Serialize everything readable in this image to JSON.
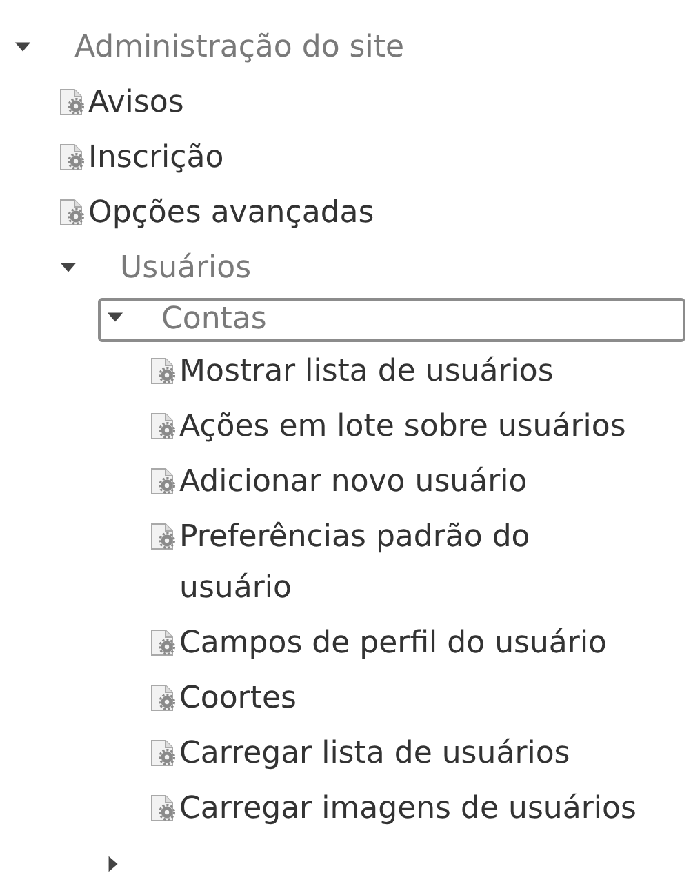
{
  "tree": [
    {
      "kind": "branch",
      "label": "Administração do site",
      "expanded": true,
      "focused": false,
      "children": [
        {
          "kind": "leaf",
          "label": "Avisos"
        },
        {
          "kind": "leaf",
          "label": "Inscrição"
        },
        {
          "kind": "leaf",
          "label": "Opções avançadas"
        },
        {
          "kind": "branch",
          "label": "Usuários",
          "expanded": true,
          "focused": false,
          "children": [
            {
              "kind": "branch",
              "label": "Contas",
              "expanded": true,
              "focused": true,
              "children": [
                {
                  "kind": "leaf",
                  "label": "Mostrar lista de usuários"
                },
                {
                  "kind": "leaf",
                  "label": "Ações em lote sobre usuários"
                },
                {
                  "kind": "leaf",
                  "label": "Adicionar novo usuário"
                },
                {
                  "kind": "leaf",
                  "label": "Preferências padrão do usuário"
                },
                {
                  "kind": "leaf",
                  "label": "Campos de perfil do usuário"
                },
                {
                  "kind": "leaf",
                  "label": "Coortes"
                },
                {
                  "kind": "leaf",
                  "label": "Carregar lista de usuários"
                },
                {
                  "kind": "leaf",
                  "label": "Carregar imagens de usuários"
                }
              ]
            },
            {
              "kind": "branch",
              "expanded": false,
              "focused": false
            }
          ]
        }
      ]
    }
  ]
}
